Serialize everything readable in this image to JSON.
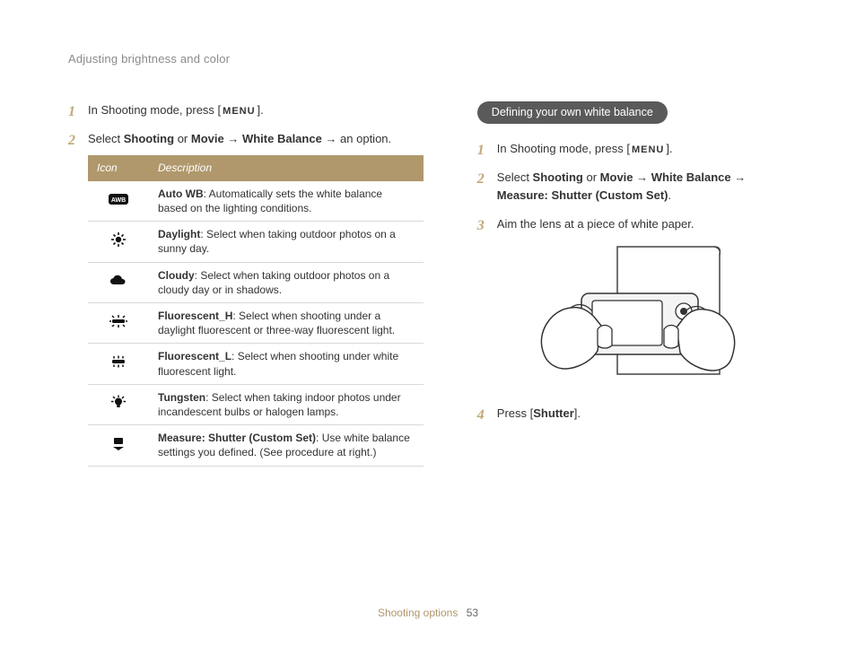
{
  "header": {
    "section_title": "Adjusting brightness and color"
  },
  "left": {
    "step1_a": "In Shooting mode, press [",
    "menu_label": "MENU",
    "step1_b": "].",
    "step2_a": "Select ",
    "step2_shooting": "Shooting",
    "step2_or": " or ",
    "step2_movie": "Movie",
    "step2_arrow1": " → ",
    "step2_wb": "White Balance",
    "step2_arrow2": " → an option.",
    "table": {
      "head_icon": "Icon",
      "head_desc": "Description",
      "rows": [
        {
          "icon": "awb",
          "term": "Auto WB",
          "desc": ": Automatically sets the white balance based on the lighting conditions."
        },
        {
          "icon": "sun",
          "term": "Daylight",
          "desc": ": Select when taking outdoor photos on a sunny day."
        },
        {
          "icon": "cloud",
          "term": "Cloudy",
          "desc": ": Select when taking outdoor photos on a cloudy day or in shadows."
        },
        {
          "icon": "flh",
          "term": "Fluorescent_H",
          "desc": ": Select when shooting under a daylight fluorescent or three-way fluorescent light."
        },
        {
          "icon": "fll",
          "term": "Fluorescent_L",
          "desc": ": Select when shooting under white fluorescent light."
        },
        {
          "icon": "bulb",
          "term": "Tungsten",
          "desc": ": Select when taking indoor photos under incandescent bulbs or halogen lamps."
        },
        {
          "icon": "cust",
          "term": "Measure: Shutter (Custom Set)",
          "desc": ": Use white balance settings you defined. (See procedure at right.)"
        }
      ]
    }
  },
  "right": {
    "pill": "Defining your own white balance",
    "step1_a": "In Shooting mode, press [",
    "menu_label": "MENU",
    "step1_b": "].",
    "step2_a": "Select ",
    "step2_shooting": "Shooting",
    "step2_or": " or ",
    "step2_movie": "Movie",
    "step2_arrow1": " → ",
    "step2_wb": "White Balance",
    "step2_arrow2": " → ",
    "step2_measure": "Measure: Shutter (Custom Set)",
    "step2_end": ".",
    "step3": "Aim the lens at a piece of white paper.",
    "step4_a": "Press [",
    "step4_shutter": "Shutter",
    "step4_b": "]."
  },
  "footer": {
    "section": "Shooting options",
    "page": "53"
  }
}
